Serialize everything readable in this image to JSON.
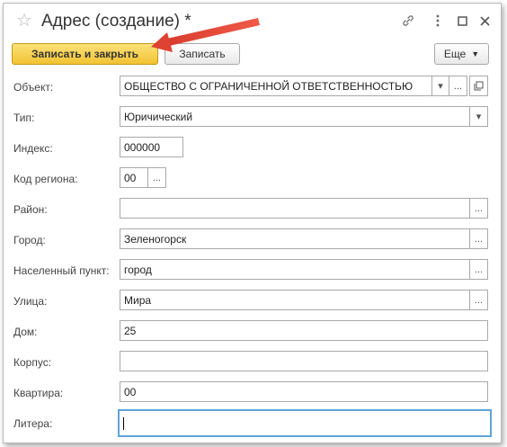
{
  "window": {
    "title": "Адрес (создание) *"
  },
  "toolbar": {
    "save_close_label": "Записать и закрыть",
    "save_label": "Записать",
    "more_label": "Еще"
  },
  "form": {
    "object": {
      "label": "Объект:",
      "value": "ОБЩЕСТВО С ОГРАНИЧЕННОЙ ОТВЕТСТВЕННОСТЬЮ"
    },
    "type": {
      "label": "Тип:",
      "value": "Юричический"
    },
    "index": {
      "label": "Индекс:",
      "value": "000000"
    },
    "region_code": {
      "label": "Код региона:",
      "value": "00"
    },
    "district": {
      "label": "Район:",
      "value": ""
    },
    "city": {
      "label": "Город:",
      "value": "Зеленогорск"
    },
    "settlement": {
      "label": "Населенный пункт:",
      "value": "город"
    },
    "street": {
      "label": "Улица:",
      "value": "Мира"
    },
    "house": {
      "label": "Дом:",
      "value": "25"
    },
    "building": {
      "label": "Корпус:",
      "value": ""
    },
    "apartment": {
      "label": "Квартира:",
      "value": "00"
    },
    "letter": {
      "label": "Литера:",
      "value": ""
    }
  },
  "icons": {
    "select_button": "...",
    "dropdown": "▾",
    "open": "⧉",
    "star": "☆",
    "link": "link-icon",
    "more": "more-icon",
    "maximize": "maximize-icon",
    "close": "close-icon"
  },
  "colors": {
    "primary_button": "#f1c232",
    "focus_border": "#5ea4d8",
    "annotation_arrow": "#e04535"
  }
}
